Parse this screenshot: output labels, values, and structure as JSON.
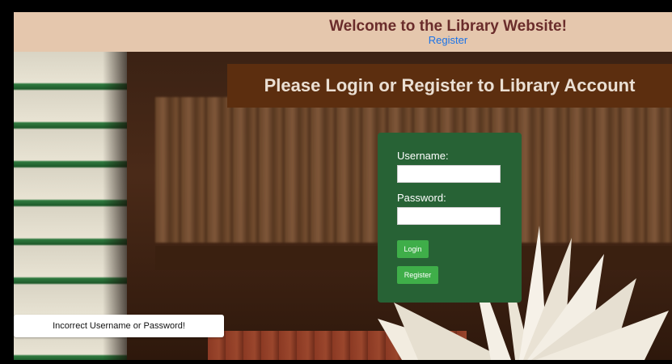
{
  "header": {
    "title": "Welcome to the Library Website!",
    "register_link": "Register"
  },
  "banner": {
    "text": "Please Login or Register to Library Account"
  },
  "login": {
    "username_label": "Username:",
    "username_value": "",
    "password_label": "Password:",
    "password_value": "",
    "login_button": "Login",
    "register_button": "Register"
  },
  "message": {
    "error": "Incorrect Username or Password!"
  },
  "colors": {
    "header_bg": "#e5c7ad",
    "header_title": "#6a2c2b",
    "link": "#1a73e8",
    "banner_bg": "#5c2e0f",
    "login_box_bg": "#276235",
    "button_bg": "#3fae49"
  }
}
